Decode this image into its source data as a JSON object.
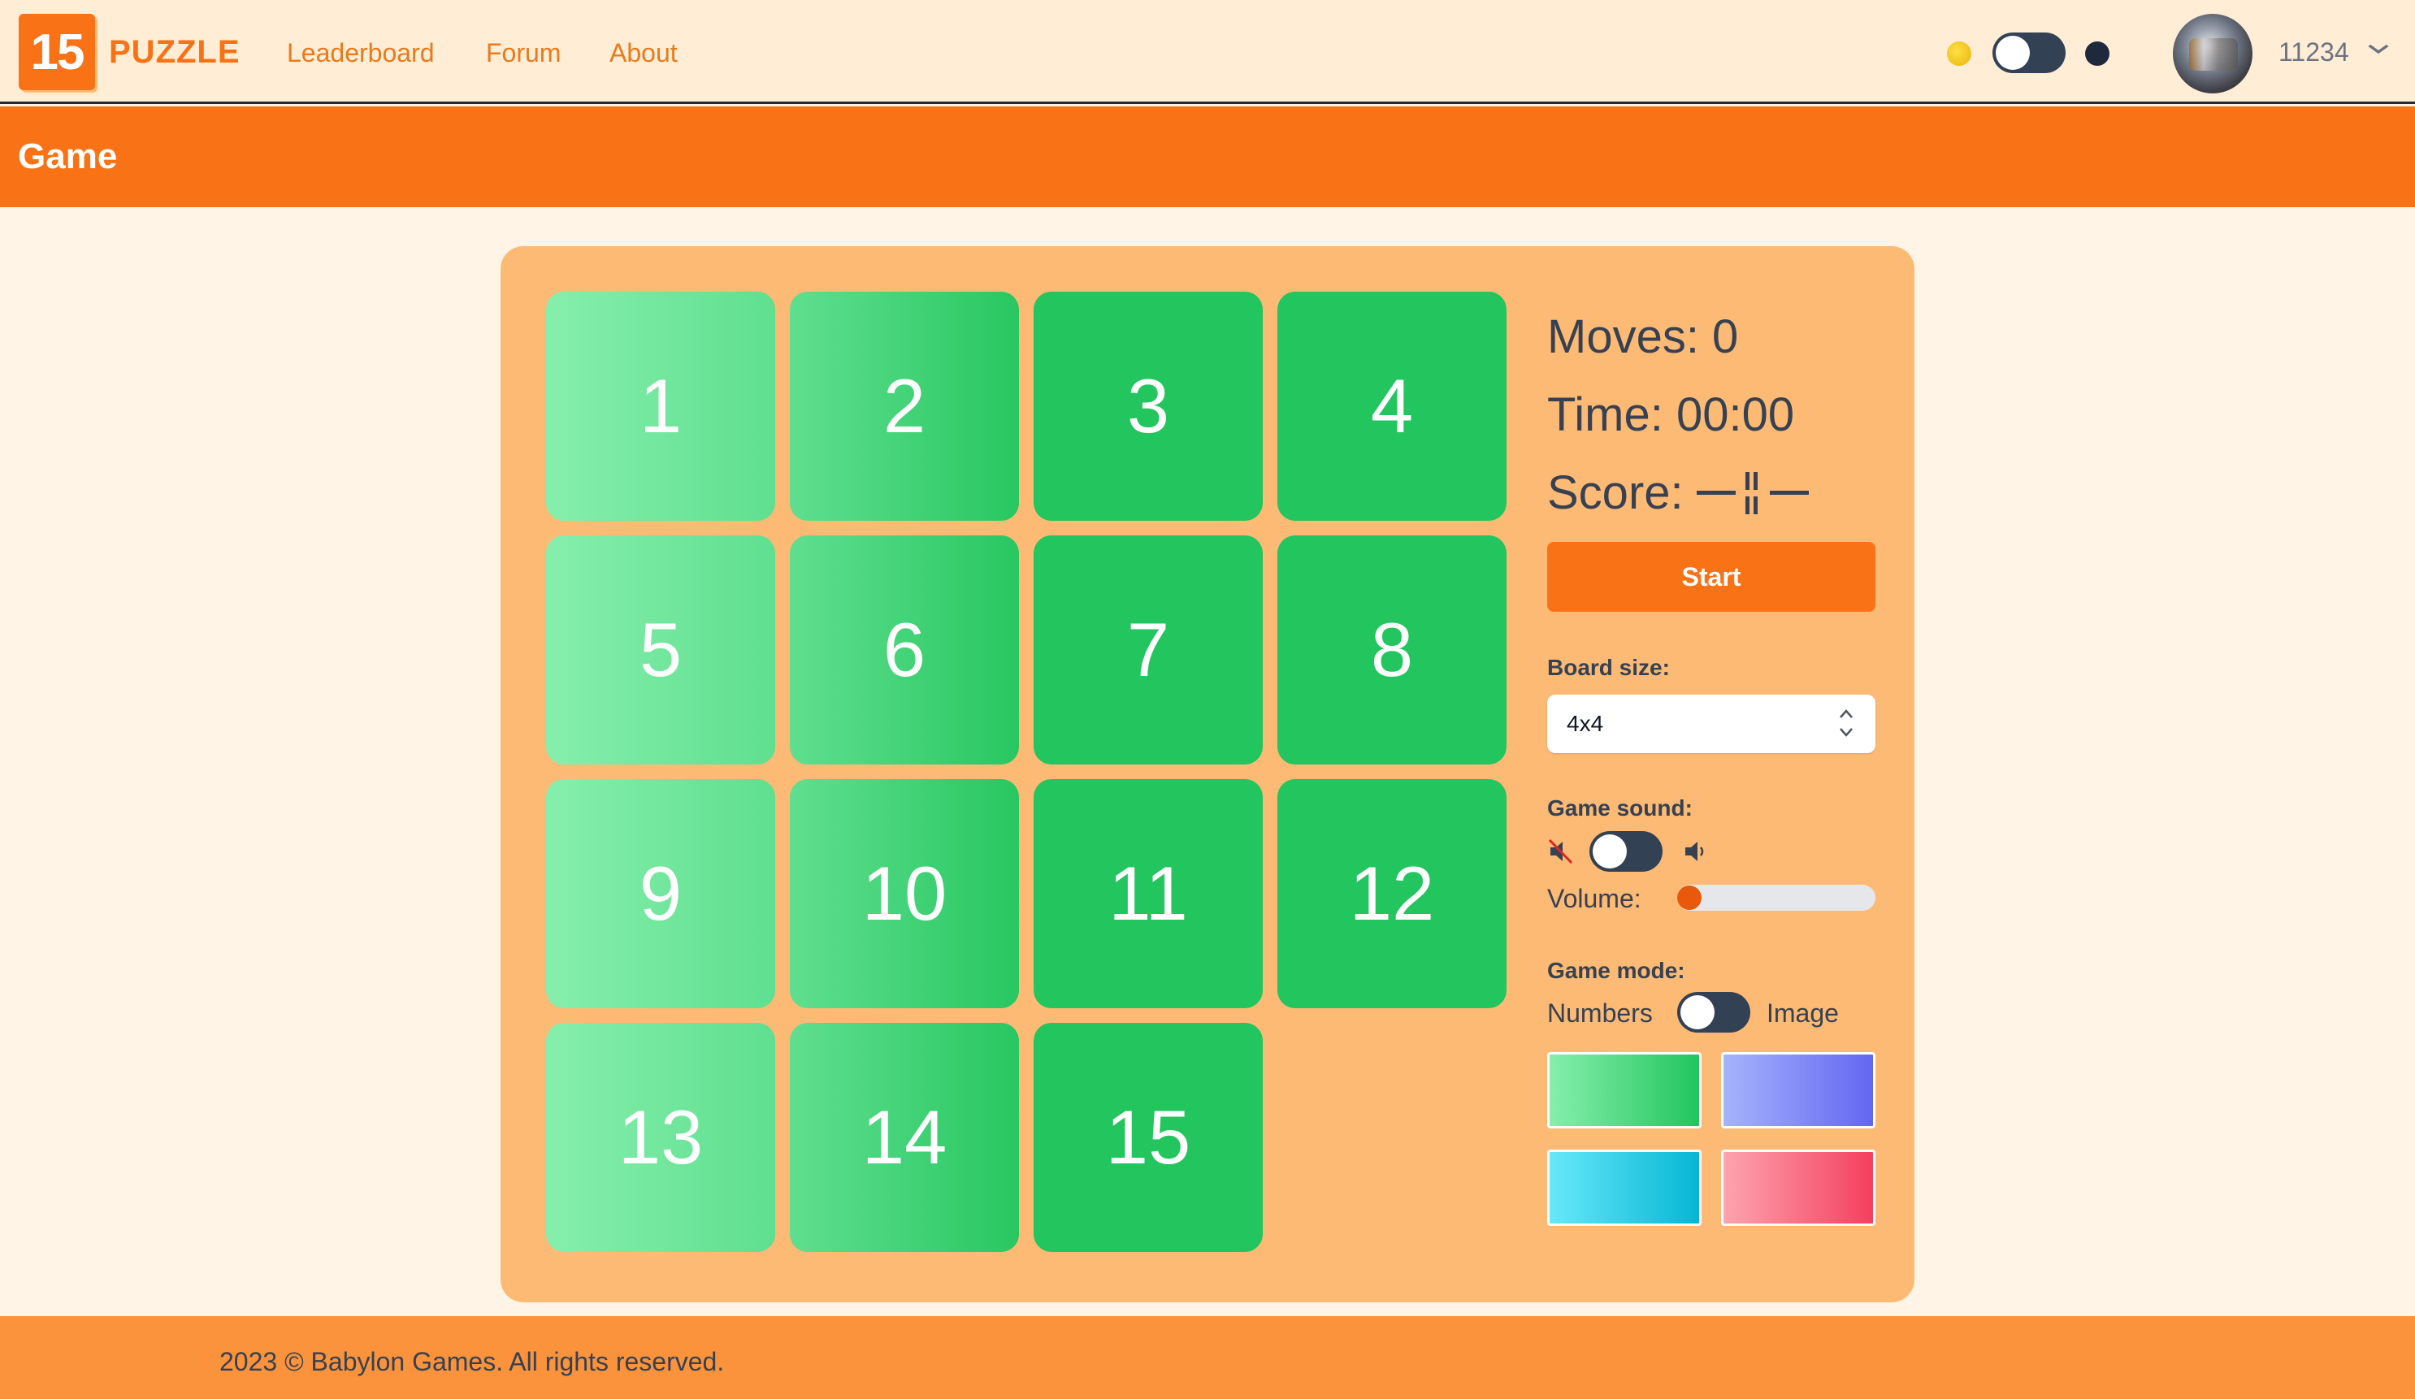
{
  "header": {
    "logo_number": "15",
    "logo_text": "PUZZLE",
    "nav": [
      {
        "label": "Leaderboard"
      },
      {
        "label": "Forum"
      },
      {
        "label": "About"
      }
    ],
    "username": "11234",
    "theme_dark_mode_on": true
  },
  "page": {
    "title": "Game"
  },
  "game": {
    "board_size_value": 4,
    "tiles": [
      "1",
      "2",
      "3",
      "4",
      "5",
      "6",
      "7",
      "8",
      "9",
      "10",
      "11",
      "12",
      "13",
      "14",
      "15"
    ],
    "moves_text": "Moves: 0",
    "time_text": "Time: 00:00",
    "score_label": "Score:",
    "start_label": "Start",
    "board_size_label": "Board size:",
    "board_size_selected": "4x4",
    "game_sound_label": "Game sound:",
    "sound_on": false,
    "volume_label": "Volume:",
    "volume_fraction": 0,
    "game_mode_label": "Game mode:",
    "mode_left_label": "Numbers",
    "mode_right_label": "Image",
    "themes": [
      {
        "name": "green",
        "from": "#86efac",
        "to": "#22c55e"
      },
      {
        "name": "indigo",
        "from": "#a5b4fc",
        "to": "#6366f1"
      },
      {
        "name": "cyan",
        "from": "#67e8f9",
        "to": "#06b6d4"
      },
      {
        "name": "rose",
        "from": "#fda4af",
        "to": "#f43f5e"
      }
    ]
  },
  "colors": {
    "accent": "#f97316",
    "panel": "#fdba74",
    "tile_green": "#22c55e"
  },
  "footer": {
    "copyright": "2023 © Babylon Games. All rights reserved."
  }
}
